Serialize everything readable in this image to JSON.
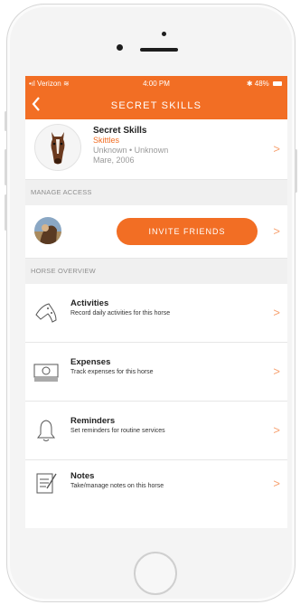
{
  "status_bar": {
    "carrier": "Verizon",
    "time": "4:00 PM",
    "battery": "48%"
  },
  "nav": {
    "back_icon": "chevron-left-icon",
    "title": "SECRET SKILLS"
  },
  "horse": {
    "name": "Secret Skills",
    "barn_name": "Skittles",
    "breed_line": "Unknown • Unknown",
    "sex_year": "Mare, 2006"
  },
  "manage_access": {
    "heading": "MANAGE ACCESS",
    "invite_label": "INVITE FRIENDS"
  },
  "overview": {
    "heading": "HORSE OVERVIEW",
    "items": [
      {
        "icon": "horseshoe-icon",
        "title": "Activities",
        "subtitle": "Record daily activities for this horse"
      },
      {
        "icon": "money-icon",
        "title": "Expenses",
        "subtitle": "Track expenses for this horse"
      },
      {
        "icon": "bell-icon",
        "title": "Reminders",
        "subtitle": "Set reminders for routine services"
      },
      {
        "icon": "notes-icon",
        "title": "Notes",
        "subtitle": "Take/manage notes on this horse"
      }
    ]
  },
  "colors": {
    "accent": "#f26e24",
    "section_bg": "#f0f0f0"
  }
}
